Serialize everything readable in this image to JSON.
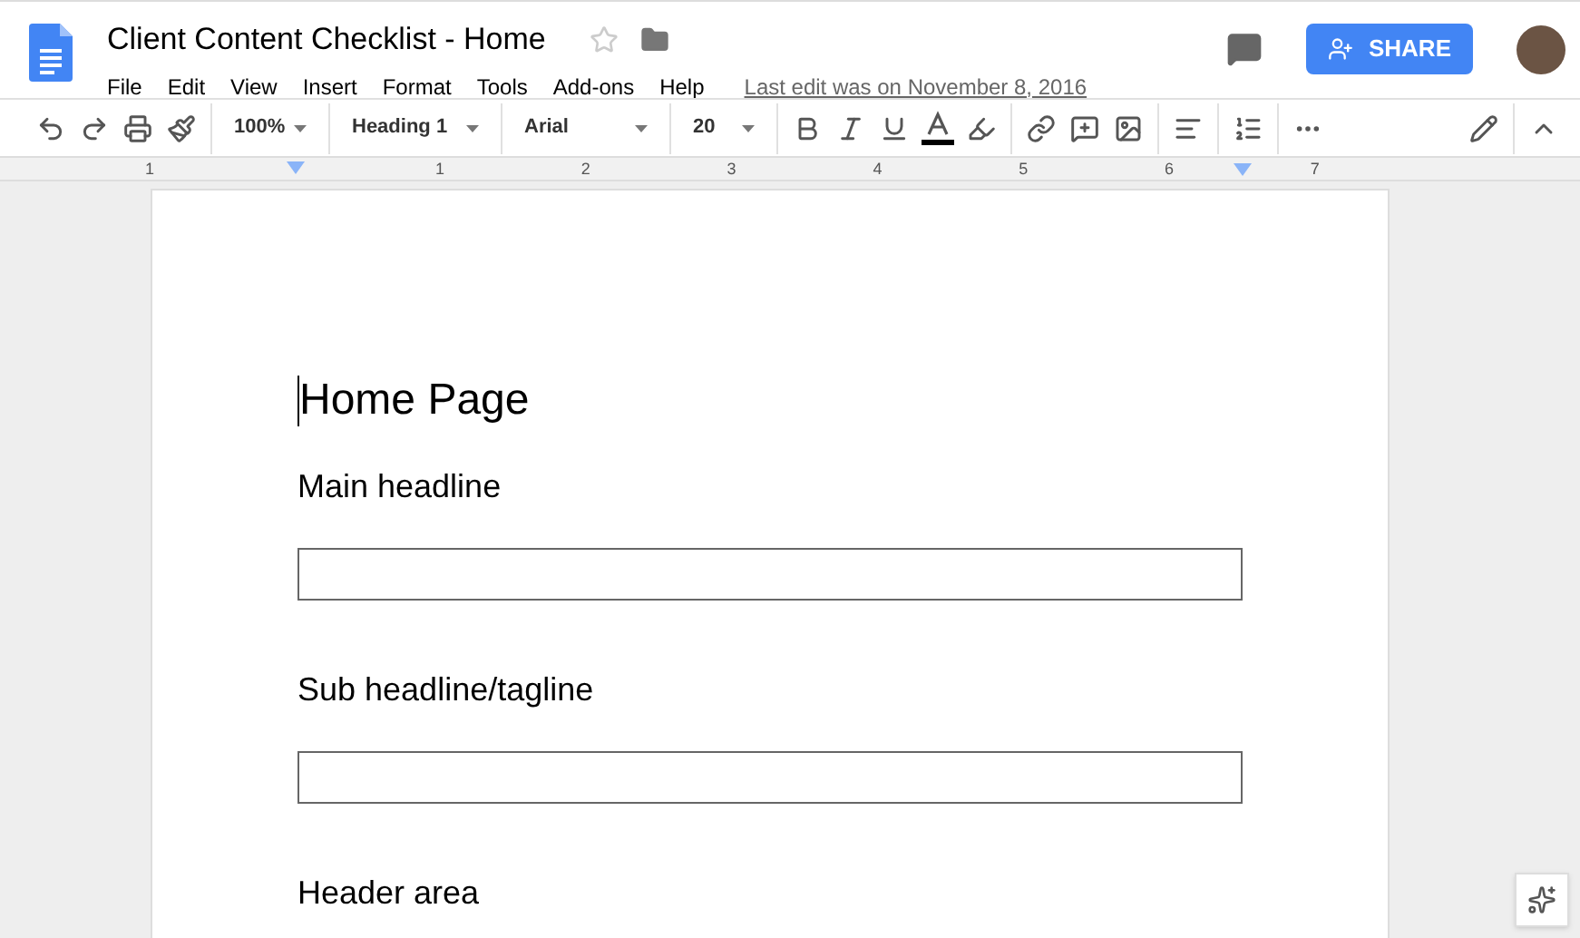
{
  "document": {
    "title": "Client Content Checklist - Home",
    "starred": false
  },
  "menu": [
    "File",
    "Edit",
    "View",
    "Insert",
    "Format",
    "Tools",
    "Add-ons",
    "Help"
  ],
  "last_edit": "Last edit was on November 8, 2016",
  "share_button": "SHARE",
  "toolbar": {
    "zoom": "100%",
    "style": "Heading 1",
    "font": "Arial",
    "size": "20"
  },
  "ruler": [
    "1",
    "1",
    "2",
    "3",
    "4",
    "5",
    "6",
    "7"
  ],
  "content": [
    {
      "kind": "title",
      "text": "Home Page"
    },
    {
      "kind": "heading",
      "text": "Main headline"
    },
    {
      "kind": "field"
    },
    {
      "kind": "heading",
      "text": "Sub headline/tagline"
    },
    {
      "kind": "field"
    },
    {
      "kind": "heading",
      "text": "Header area"
    }
  ]
}
